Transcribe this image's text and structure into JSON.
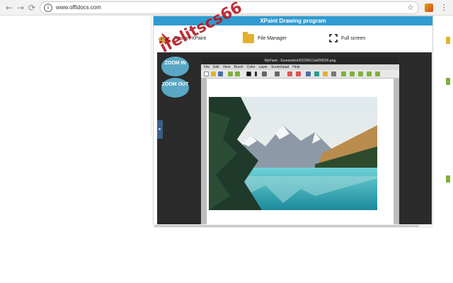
{
  "browser": {
    "back": "←",
    "forward": "→",
    "reload": "⟳",
    "info": "i",
    "url": "www.offidocs.com",
    "star": "☆",
    "menu": "⋮"
  },
  "app": {
    "title": "XPaint Drawing program",
    "restart_label": "Restart XPaint",
    "file_manager_label": "File Manager",
    "fullscreen_label": "Full screen",
    "zoom_in": "ZOOM IN",
    "zoom_out": "ZOOM OUT",
    "side_tab": "▸"
  },
  "mypaint": {
    "title": "MyPaint - Screenshot20220612at200026.png",
    "menu": [
      "File",
      "Edit",
      "View",
      "Brush",
      "Color",
      "Layer",
      "Scratchpad",
      "Help"
    ]
  },
  "watermark": "ifelitscs66",
  "colors": {
    "title_bar": "#2f9bd0",
    "zoom_button": "#5aa7c5",
    "viewer_bg": "#2b2b2b",
    "watermark": "#b5121b"
  }
}
